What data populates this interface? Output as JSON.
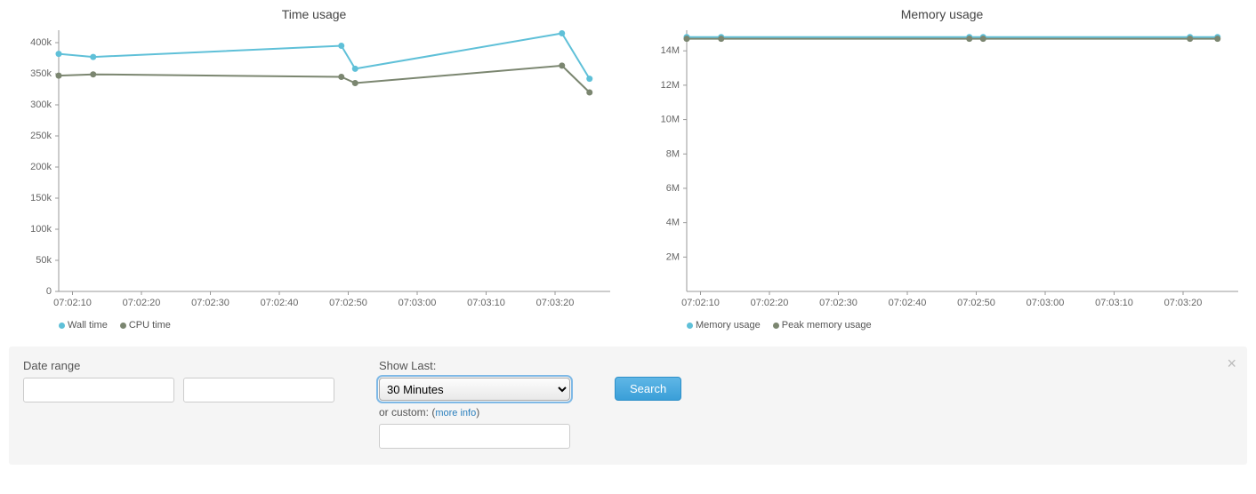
{
  "chart_data": [
    {
      "id": "time",
      "type": "line",
      "title": "Time usage",
      "x_ticks": [
        "07:02:10",
        "07:02:20",
        "07:02:30",
        "07:02:40",
        "07:02:50",
        "07:03:00",
        "07:03:10",
        "07:03:20"
      ],
      "y_ticks": [
        0,
        50000,
        100000,
        150000,
        200000,
        250000,
        300000,
        350000,
        400000
      ],
      "y_tick_labels": [
        "0",
        "50k",
        "100k",
        "150k",
        "200k",
        "250k",
        "300k",
        "350k",
        "400k"
      ],
      "x_min": 0,
      "x_max": 80,
      "y_min": 0,
      "y_max": 420000,
      "series": [
        {
          "name": "Wall time",
          "color": "#5fc0d8",
          "points": [
            {
              "x": 0,
              "y": 382000
            },
            {
              "x": 5,
              "y": 377000
            },
            {
              "x": 41,
              "y": 395000
            },
            {
              "x": 43,
              "y": 358000
            },
            {
              "x": 73,
              "y": 415000
            },
            {
              "x": 77,
              "y": 342000
            }
          ]
        },
        {
          "name": "CPU time",
          "color": "#7b8670",
          "points": [
            {
              "x": 0,
              "y": 347000
            },
            {
              "x": 5,
              "y": 349000
            },
            {
              "x": 41,
              "y": 345000
            },
            {
              "x": 43,
              "y": 335000
            },
            {
              "x": 73,
              "y": 363000
            },
            {
              "x": 77,
              "y": 320000
            }
          ]
        }
      ],
      "legend": [
        "Wall time",
        "CPU time"
      ],
      "legend_colors": [
        "#5fc0d8",
        "#7b8670"
      ]
    },
    {
      "id": "memory",
      "type": "line",
      "title": "Memory usage",
      "x_ticks": [
        "07:02:10",
        "07:02:20",
        "07:02:30",
        "07:02:40",
        "07:02:50",
        "07:03:00",
        "07:03:10",
        "07:03:20"
      ],
      "y_ticks": [
        2000000,
        4000000,
        6000000,
        8000000,
        10000000,
        12000000,
        14000000
      ],
      "y_tick_labels": [
        "2M",
        "4M",
        "6M",
        "8M",
        "10M",
        "12M",
        "14M"
      ],
      "x_min": 0,
      "x_max": 80,
      "y_min": 0,
      "y_max": 15200000,
      "series": [
        {
          "name": "Memory usage",
          "color": "#5fc0d8",
          "points": [
            {
              "x": 0,
              "y": 14800000
            },
            {
              "x": 5,
              "y": 14800000
            },
            {
              "x": 41,
              "y": 14800000
            },
            {
              "x": 43,
              "y": 14800000
            },
            {
              "x": 73,
              "y": 14800000
            },
            {
              "x": 77,
              "y": 14800000
            }
          ]
        },
        {
          "name": "Peak memory usage",
          "color": "#7b8670",
          "points": [
            {
              "x": 0,
              "y": 14700000
            },
            {
              "x": 5,
              "y": 14700000
            },
            {
              "x": 41,
              "y": 14700000
            },
            {
              "x": 43,
              "y": 14700000
            },
            {
              "x": 73,
              "y": 14700000
            },
            {
              "x": 77,
              "y": 14700000
            }
          ]
        }
      ],
      "legend": [
        "Memory usage",
        "Peak memory usage"
      ],
      "legend_colors": [
        "#5fc0d8",
        "#7b8670"
      ]
    }
  ],
  "controls": {
    "date_range_label": "Date range",
    "show_last_label": "Show Last:",
    "show_last_value": "30 Minutes",
    "or_custom_prefix": "or custom: (",
    "more_info": "more info",
    "or_custom_suffix": ")",
    "search_label": "Search"
  }
}
